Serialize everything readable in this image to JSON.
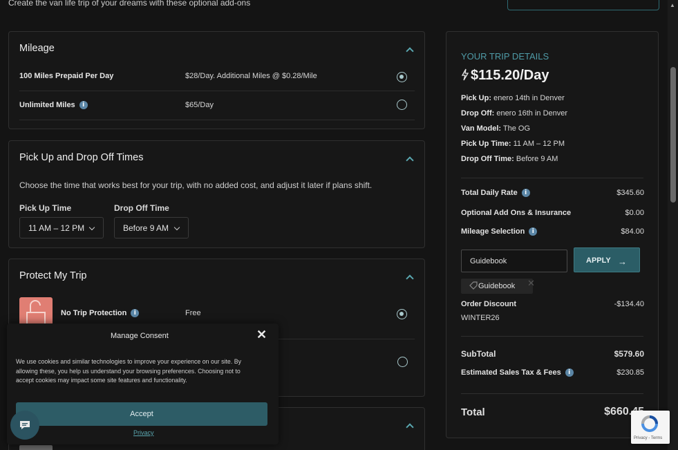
{
  "header": {
    "subtitle": "Create the van life trip of your dreams with these optional add-ons"
  },
  "mileage": {
    "title": "Mileage",
    "options": [
      {
        "name": "100 Miles Prepaid Per Day",
        "price": "$28/Day. Additional Miles @ $0.28/Mile",
        "selected": true
      },
      {
        "name": "Unlimited Miles",
        "price": "$65/Day",
        "selected": false
      }
    ]
  },
  "times": {
    "title": "Pick Up and Drop Off Times",
    "description": "Choose the time that works best for your trip, with no added cost, and adjust it later if plans shift.",
    "pickup_label": "Pick Up Time",
    "pickup_value": "11 AM – 12 PM",
    "dropoff_label": "Drop Off Time",
    "dropoff_value": "Before 9 AM"
  },
  "protection": {
    "title": "Protect My Trip",
    "options": [
      {
        "name": "No Trip Protection",
        "price": "Free",
        "selected": true
      }
    ]
  },
  "trip": {
    "heading": "YOUR TRIP DETAILS",
    "rate": "$115.20/Day",
    "details": [
      {
        "label": "Pick Up:",
        "value": "enero 14th in Denver"
      },
      {
        "label": "Drop Off:",
        "value": "enero 16th in Denver"
      },
      {
        "label": "Van Model:",
        "value": "The OG"
      },
      {
        "label": "Pick Up Time:",
        "value": "11 AM – 12 PM"
      },
      {
        "label": "Drop Off Time:",
        "value": "Before 9 AM"
      }
    ],
    "total_daily_rate_label": "Total Daily Rate",
    "total_daily_rate": "$345.60",
    "addons_label": "Optional Add Ons & Insurance",
    "addons": "$0.00",
    "mileage_label": "Mileage Selection",
    "mileage": "$84.00",
    "coupon_value": "Guidebook",
    "apply_label": "APPLY",
    "chip_label": "Guidebook",
    "discount_label": "Order Discount",
    "discount_value": "-$134.40",
    "discount_code": "WINTER26",
    "subtotal_label": "SubTotal",
    "subtotal": "$579.60",
    "tax_label": "Estimated Sales Tax & Fees",
    "tax": "$230.85",
    "total_label": "Total",
    "total": "$660.45"
  },
  "consent": {
    "title": "Manage Consent",
    "text": "We use cookies and similar technologies to improve your experience on our site. By allowing these, you help us understand your browsing preferences. Choosing not to accept cookies may impact some site features and functionality.",
    "accept_label": "Accept",
    "privacy_label": "Privacy"
  },
  "recaptcha": {
    "text": "Privacy - Terms"
  },
  "colors": {
    "accent": "#2b5d66",
    "teal_text": "#4f9ba7",
    "lock_box": "#e07e73"
  },
  "icons": [
    "chevron-up-icon",
    "info-icon",
    "lightning-icon",
    "arrow-right-icon",
    "tag-icon",
    "close-icon",
    "lock-icon",
    "chat-icon"
  ]
}
